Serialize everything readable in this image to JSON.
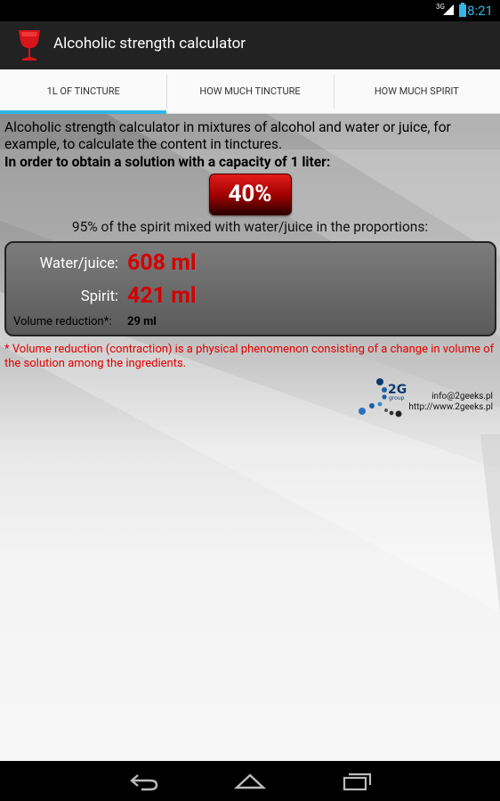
{
  "status_bar": {
    "network": "3G",
    "time": "8:21"
  },
  "app": {
    "title": "Alcoholic strength calculator",
    "icon": "wine-glass-icon"
  },
  "tabs": [
    {
      "label": "1L OF TINCTURE",
      "active": true
    },
    {
      "label": "HOW MUCH TINCTURE",
      "active": false
    },
    {
      "label": "HOW MUCH SPIRIT",
      "active": false
    }
  ],
  "main": {
    "intro": "Alcoholic strength calculator in mixtures of alcohol and water or juice, for example, to calculate the content in tinctures.",
    "subtitle": "In order to obtain a solution with a capacity of 1 liter:",
    "percent": "40%",
    "proportions": "95% of the spirit mixed with water/juice in the proportions:",
    "result": {
      "water_label": "Water/juice:",
      "water_value": "608 ml",
      "spirit_label": "Spirit:",
      "spirit_value": "421 ml",
      "volume_reduction_label": "Volume reduction*:",
      "volume_reduction_value": "29 ml"
    },
    "footnote": "* Volume reduction (contraction) is a physical phenomenon consisting of a change in volume of the solution among the ingredients."
  },
  "logo": {
    "text": "2G",
    "sub": "group",
    "email": "info@2geeks.pl",
    "url": "http://www.2geeks.pl"
  },
  "nav": {
    "back_icon": "back-icon",
    "home_icon": "home-icon",
    "recents_icon": "recents-icon"
  },
  "colors": {
    "accent": "#33b5e5",
    "value_red": "#d40000",
    "footnote_red": "#e00000"
  }
}
